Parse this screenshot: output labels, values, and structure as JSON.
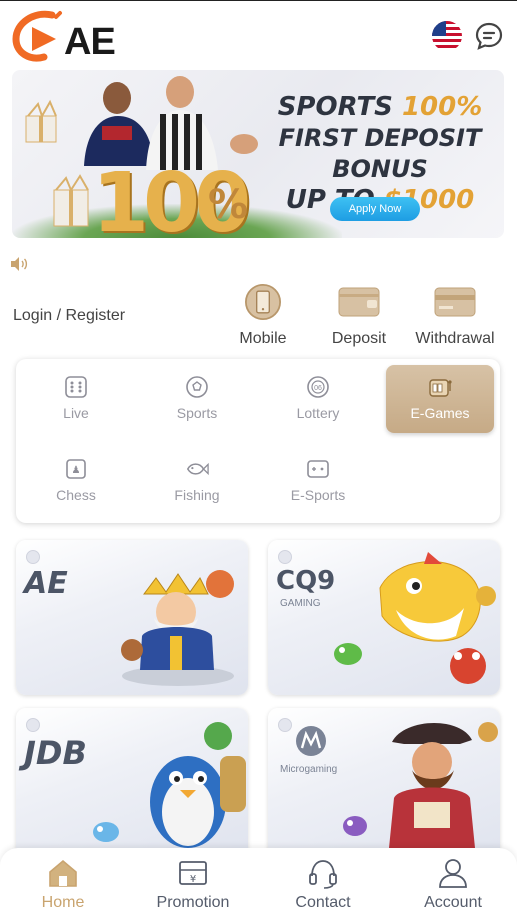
{
  "header": {
    "logo_text": "AE",
    "language_icon": "us-flag-icon",
    "chat_icon": "chat-bubble-icon"
  },
  "banner": {
    "line1_a": "SPORTS ",
    "line1_b": "100%",
    "line2": "FIRST DEPOSIT BONUS",
    "line3_a": "UP TO ",
    "line3_b": "$1000",
    "big_number": "100",
    "big_pct": "%",
    "apply_label": "Apply Now"
  },
  "announcement": {
    "icon": "speaker-icon"
  },
  "account": {
    "login_label": "Login / Register"
  },
  "quick_actions": [
    {
      "label": "Mobile",
      "icon": "mobile-phone-icon"
    },
    {
      "label": "Deposit",
      "icon": "wallet-icon"
    },
    {
      "label": "Withdrawal",
      "icon": "card-icon"
    }
  ],
  "categories": [
    {
      "label": "Live",
      "icon": "dice-icon",
      "active": false
    },
    {
      "label": "Sports",
      "icon": "soccer-ball-icon",
      "active": false
    },
    {
      "label": "Lottery",
      "icon": "lottery-ball-icon",
      "active": false
    },
    {
      "label": "E-Games",
      "icon": "slot-machine-icon",
      "active": true
    },
    {
      "label": "Chess",
      "icon": "chess-icon",
      "active": false
    },
    {
      "label": "Fishing",
      "icon": "fish-icon",
      "active": false
    },
    {
      "label": "E-Sports",
      "icon": "gamepad-icon",
      "active": false
    }
  ],
  "providers": [
    {
      "name": "AE",
      "sub": ""
    },
    {
      "name": "CQ9",
      "sub": "GAMING"
    },
    {
      "name": "JDB",
      "sub": ""
    },
    {
      "name": "",
      "sub": "Microgaming"
    }
  ],
  "bottom_nav": [
    {
      "label": "Home",
      "icon": "home-icon",
      "active": true
    },
    {
      "label": "Promotion",
      "icon": "promotion-ticket-icon",
      "active": false
    },
    {
      "label": "Contact",
      "icon": "headset-icon",
      "active": false
    },
    {
      "label": "Account",
      "icon": "user-icon",
      "active": false
    }
  ],
  "colors": {
    "accent": "#c9a46f",
    "apply_button": "#2aa8ea",
    "logo_orange": "#f06a24"
  }
}
